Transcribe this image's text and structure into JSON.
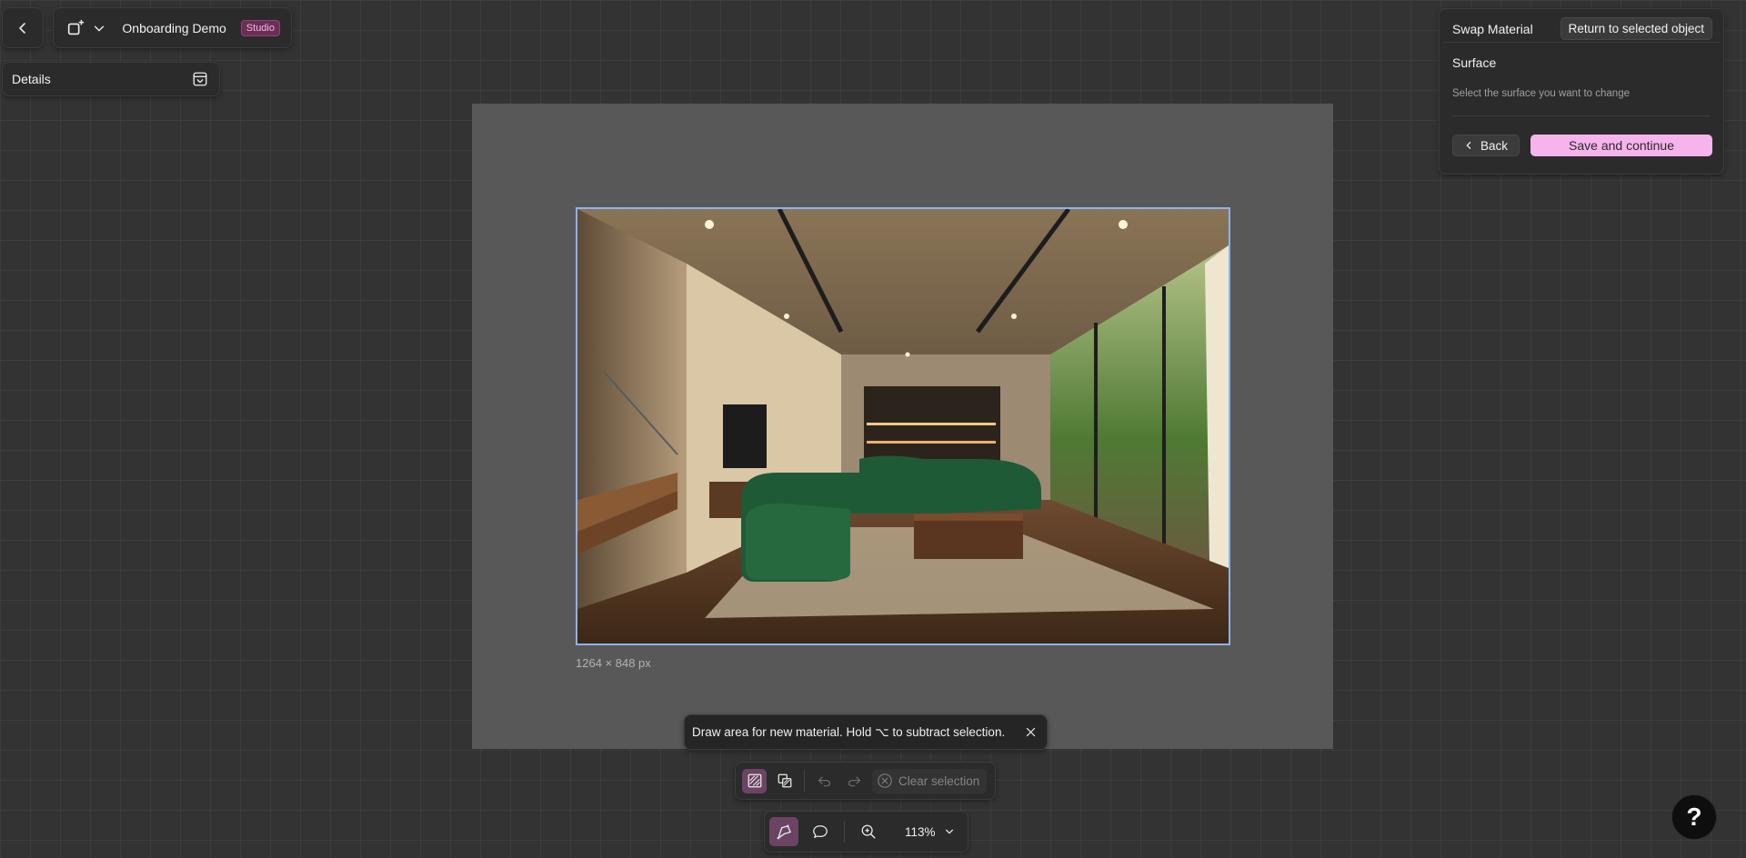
{
  "header": {
    "project_name": "Onboarding Demo",
    "badge": "Studio"
  },
  "details": {
    "title": "Details"
  },
  "swap_panel": {
    "title": "Swap Material",
    "return_label": "Return to selected object",
    "section_title": "Surface",
    "hint": "Select the surface you want to change",
    "back_label": "Back",
    "save_label": "Save and continue"
  },
  "canvas": {
    "dimensions": "1264 × 848 px"
  },
  "hint_toast": {
    "message": "Draw area for new material. Hold ⌥ to subtract selection."
  },
  "selection_toolbar": {
    "clear_label": "Clear selection"
  },
  "view_toolbar": {
    "zoom": "113%"
  },
  "help": {
    "label": "?"
  },
  "colors": {
    "accent": "#f7b3ec",
    "selection_outline": "#8ab4f0",
    "badge_bg": "#6a2f55",
    "canvas_bg": "#333333"
  },
  "icons": {
    "back": "chevron-left-icon",
    "project": "shape-add-icon",
    "dropdown": "chevron-down-icon",
    "collapse": "collapse-panel-icon",
    "close": "close-icon",
    "brush": "brush-select-icon",
    "object_select": "object-select-icon",
    "undo": "undo-icon",
    "redo": "redo-icon",
    "clear": "clear-circle-icon",
    "pointer": "pointer-tool-icon",
    "comment": "comment-icon",
    "zoom": "zoom-icon",
    "help": "help-icon"
  }
}
